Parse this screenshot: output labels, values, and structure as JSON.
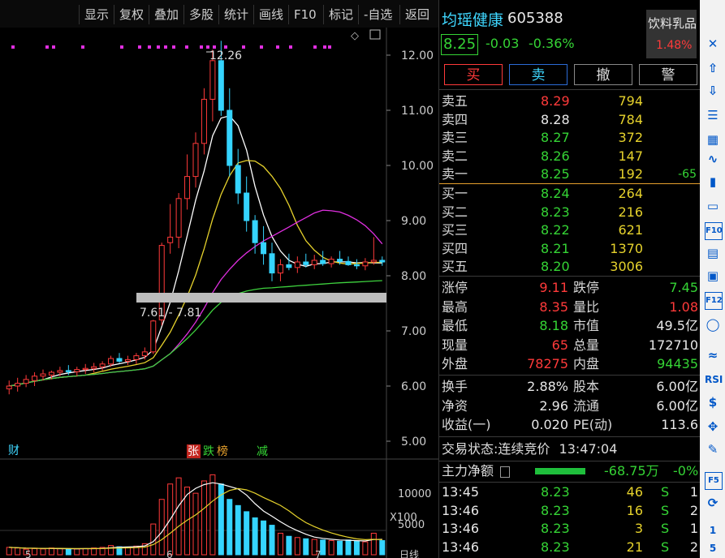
{
  "toolbar": {
    "items": [
      "显示",
      "复权",
      "叠加",
      "多股",
      "统计",
      "画线",
      "F10",
      "标记",
      "-自选",
      "返回"
    ]
  },
  "chart": {
    "price_axis": [
      "12.00",
      "11.00",
      "10.00",
      "9.00",
      "8.00",
      "7.00",
      "6.00",
      "5.00"
    ],
    "high_label": "12.26",
    "range_label": "7.61 - 7.81",
    "markers": {
      "cai": "财",
      "zhang": "张",
      "die": "跌",
      "bang": "榜",
      "jian": "减"
    },
    "volume_axis": [
      "10000",
      "5000"
    ],
    "volume_unit": "X100",
    "x_ticks": [
      "5",
      "6",
      "7"
    ],
    "period": "日线"
  },
  "chart_data": {
    "type": "candlestick",
    "candles": [
      [
        5.95,
        6.1,
        5.85,
        6.0
      ],
      [
        6.0,
        6.15,
        5.9,
        6.05
      ],
      [
        6.05,
        6.2,
        5.98,
        6.12
      ],
      [
        6.1,
        6.25,
        6.0,
        6.18
      ],
      [
        6.18,
        6.3,
        6.1,
        6.22
      ],
      [
        6.2,
        6.28,
        6.12,
        6.25
      ],
      [
        6.25,
        6.35,
        6.18,
        6.28
      ],
      [
        6.28,
        6.38,
        6.2,
        6.26
      ],
      [
        6.26,
        6.35,
        6.18,
        6.3
      ],
      [
        6.3,
        6.4,
        6.22,
        6.32
      ],
      [
        6.32,
        6.42,
        6.25,
        6.35
      ],
      [
        6.35,
        6.45,
        6.28,
        6.4
      ],
      [
        6.4,
        6.55,
        6.35,
        6.5
      ],
      [
        6.5,
        6.6,
        6.42,
        6.45
      ],
      [
        6.45,
        6.55,
        6.38,
        6.48
      ],
      [
        6.48,
        6.6,
        6.4,
        6.55
      ],
      [
        6.55,
        6.7,
        6.48,
        6.62
      ],
      [
        6.62,
        7.2,
        6.58,
        7.18
      ],
      [
        7.2,
        8.6,
        7.1,
        8.55
      ],
      [
        8.6,
        9.3,
        8.4,
        8.7
      ],
      [
        8.7,
        9.5,
        8.5,
        9.4
      ],
      [
        9.4,
        10.2,
        9.2,
        9.8
      ],
      [
        9.8,
        10.6,
        9.6,
        10.4
      ],
      [
        10.4,
        11.4,
        10.2,
        11.2
      ],
      [
        11.2,
        12.1,
        10.8,
        11.9
      ],
      [
        11.9,
        12.26,
        10.9,
        11.0
      ],
      [
        11.0,
        11.4,
        9.8,
        10.0
      ],
      [
        10.0,
        10.3,
        9.3,
        9.5
      ],
      [
        9.5,
        9.8,
        8.8,
        9.0
      ],
      [
        9.0,
        9.1,
        8.4,
        8.6
      ],
      [
        8.6,
        8.9,
        8.2,
        8.4
      ],
      [
        8.4,
        8.6,
        7.9,
        8.05
      ],
      [
        8.05,
        8.3,
        7.9,
        8.2
      ],
      [
        8.2,
        8.4,
        8.1,
        8.15
      ],
      [
        8.15,
        8.35,
        8.05,
        8.25
      ],
      [
        8.25,
        8.4,
        8.15,
        8.2
      ],
      [
        8.2,
        8.38,
        8.12,
        8.28
      ],
      [
        8.28,
        8.45,
        8.18,
        8.22
      ],
      [
        8.22,
        8.35,
        8.15,
        8.3
      ],
      [
        8.3,
        8.45,
        8.2,
        8.26
      ],
      [
        8.26,
        8.35,
        8.18,
        8.2
      ],
      [
        8.2,
        8.3,
        8.12,
        8.18
      ],
      [
        8.18,
        8.32,
        8.1,
        8.25
      ],
      [
        8.25,
        8.7,
        8.2,
        8.28
      ],
      [
        8.28,
        8.35,
        8.18,
        8.25
      ]
    ],
    "volumes": [
      1200,
      1100,
      900,
      1000,
      950,
      1100,
      1000,
      900,
      950,
      1000,
      1100,
      1200,
      1500,
      1300,
      1200,
      1400,
      1800,
      5000,
      9000,
      11500,
      12500,
      11000,
      10000,
      12000,
      13000,
      11500,
      9000,
      8000,
      7000,
      6000,
      5500,
      4800,
      3500,
      3000,
      2800,
      2600,
      2500,
      2400,
      2300,
      2200,
      2400,
      2200,
      2100,
      3500,
      2300
    ],
    "ylim": [
      5.0,
      12.5
    ]
  },
  "quote": {
    "name": "均瑶健康",
    "code": "605388",
    "price": "8.25",
    "change": "-0.03",
    "change_pct": "-0.36%",
    "sector": "饮料乳品",
    "sector_pct": "1.48%"
  },
  "actions": {
    "buy": "买",
    "sell": "卖",
    "cancel": "撤",
    "alert": "警"
  },
  "asks": [
    {
      "label": "卖五",
      "price": "8.29",
      "vol": "794",
      "diff": ""
    },
    {
      "label": "卖四",
      "price": "8.28",
      "vol": "784",
      "diff": ""
    },
    {
      "label": "卖三",
      "price": "8.27",
      "vol": "372",
      "diff": ""
    },
    {
      "label": "卖二",
      "price": "8.26",
      "vol": "147",
      "diff": ""
    },
    {
      "label": "卖一",
      "price": "8.25",
      "vol": "192",
      "diff": "-65"
    }
  ],
  "bids": [
    {
      "label": "买一",
      "price": "8.24",
      "vol": "264"
    },
    {
      "label": "买二",
      "price": "8.23",
      "vol": "216"
    },
    {
      "label": "买三",
      "price": "8.22",
      "vol": "621"
    },
    {
      "label": "买四",
      "price": "8.21",
      "vol": "1370"
    },
    {
      "label": "买五",
      "price": "8.20",
      "vol": "3006"
    }
  ],
  "stats1": [
    {
      "l1": "涨停",
      "v1": "9.11",
      "c1": "red",
      "l2": "跌停",
      "v2": "7.45",
      "c2": "green"
    },
    {
      "l1": "最高",
      "v1": "8.35",
      "c1": "red",
      "l2": "量比",
      "v2": "1.08",
      "c2": "red"
    },
    {
      "l1": "最低",
      "v1": "8.18",
      "c1": "green",
      "l2": "市值",
      "v2": "49.5亿",
      "c2": "white"
    },
    {
      "l1": "现量",
      "v1": "65",
      "c1": "red",
      "l2": "总量",
      "v2": "172710",
      "c2": "white"
    },
    {
      "l1": "外盘",
      "v1": "78275",
      "c1": "red",
      "l2": "内盘",
      "v2": "94435",
      "c2": "green"
    }
  ],
  "stats2": [
    {
      "l1": "换手",
      "v1": "2.88%",
      "l2": "股本",
      "v2": "6.00亿"
    },
    {
      "l1": "净资",
      "v1": "2.96",
      "l2": "流通",
      "v2": "6.00亿"
    },
    {
      "l1": "收益(一)",
      "v1": "0.020",
      "l2": "PE(动)",
      "v2": "113.6"
    }
  ],
  "status": {
    "label": "交易状态:",
    "state": "连续竞价",
    "time": "13:47:04"
  },
  "main_flow": {
    "label": "主力净额",
    "amount": "-68.75万",
    "pct": "-0%"
  },
  "ticks": [
    {
      "time": "13:45",
      "price": "8.23",
      "vol": "46",
      "side": "S",
      "n": "1"
    },
    {
      "time": "13:46",
      "price": "8.23",
      "vol": "16",
      "side": "S",
      "n": "2"
    },
    {
      "time": "13:46",
      "price": "8.23",
      "vol": "3",
      "side": "S",
      "n": "1"
    },
    {
      "time": "13:46",
      "price": "8.23",
      "vol": "21",
      "side": "S",
      "n": "2"
    }
  ],
  "colors": {
    "up": "#ff3a3a",
    "down": "#35d4ff",
    "ma5": "#ffffff",
    "ma10": "#e6d22c",
    "ma20": "#e02fe0",
    "ma60": "#3ed23e",
    "accent": "#2b6bd6"
  },
  "side_icons": [
    "close-icon",
    "arrow-up-icon",
    "arrow-down-icon",
    "watchlist-icon",
    "grid-icon",
    "line-chart-icon",
    "candle-icon",
    "window-icon",
    "f10-icon",
    "cal-icon",
    "doc-icon",
    "f12-icon",
    "circle-icon",
    "wave-icon",
    "rsi-icon",
    "dollar-icon",
    "move-icon",
    "pencil-icon",
    "f5-icon",
    "refresh-icon"
  ],
  "side_labels": {
    "f10": "F10",
    "f12": "F12",
    "rsi": "RSI",
    "f5": "F5",
    "page1": "1",
    "page5": "5"
  }
}
